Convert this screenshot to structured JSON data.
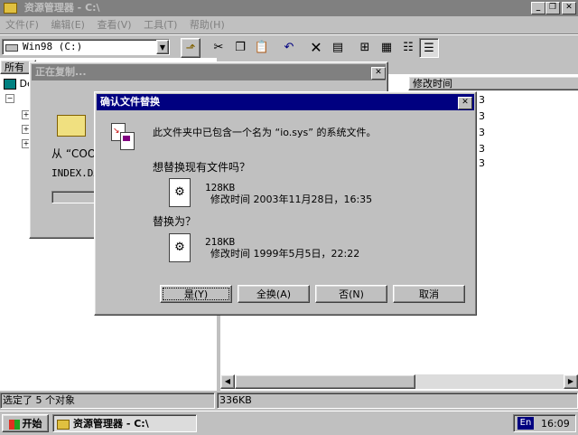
{
  "window": {
    "title": "资源管理器 - C:\\"
  },
  "menu": [
    "文件(F)",
    "编辑(E)",
    "查看(V)",
    "工具(T)",
    "帮助(H)"
  ],
  "address": {
    "value": "Win98 (C:)"
  },
  "left_panel": {
    "header": "所有",
    "root": "De"
  },
  "right_panel": {
    "col_modified": "修改时间",
    "scroll_digits": [
      "3",
      "3",
      "3",
      "3",
      "3"
    ]
  },
  "copy_dialog": {
    "title": "正在复制...",
    "from_text": "从 “COOK",
    "file_text": "INDEX.DA"
  },
  "confirm_dialog": {
    "title": "确认文件替换",
    "message": "此文件夹中已包含一个名为 “io.sys” 的系统文件。",
    "question": "想替换现有文件吗？",
    "existing": {
      "size": "128KB",
      "modified": "修改时间 2003年11月28日，16:35"
    },
    "replace_with_label": "替换为？",
    "new": {
      "size": "218KB",
      "modified": "修改时间 1999年5月5日，22:22"
    },
    "buttons": {
      "yes": "是(Y)",
      "yes_all": "全换(A)",
      "no": "否(N)",
      "cancel": "取消"
    }
  },
  "status": {
    "left": "选定了 5 个对象",
    "right": "336KB"
  },
  "taskbar": {
    "start": "开始",
    "task": "资源管理器 - C:\\",
    "lang": "En",
    "time": "16:09"
  }
}
